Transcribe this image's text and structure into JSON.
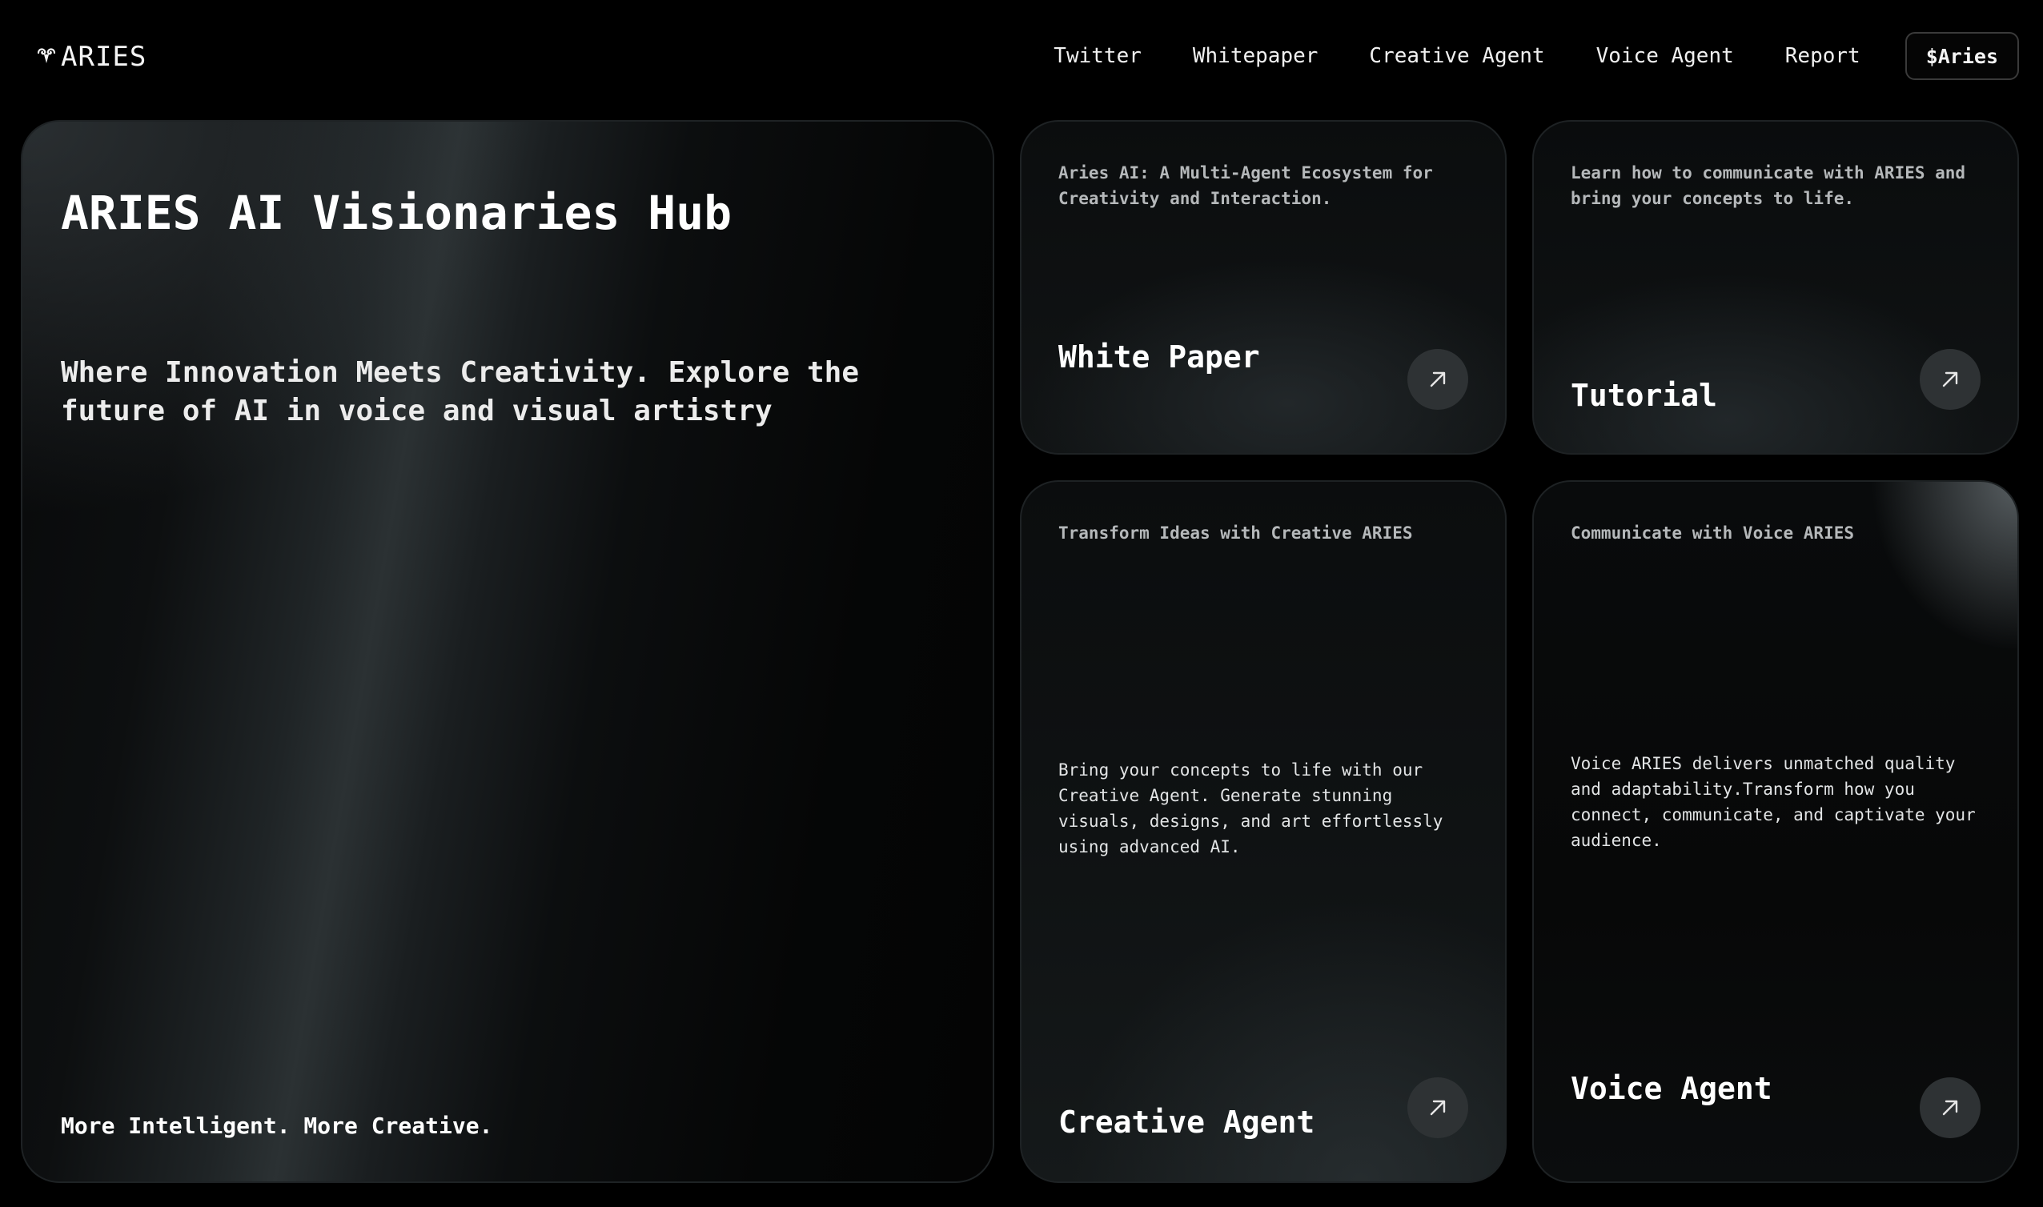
{
  "header": {
    "logo_text": "ARIES",
    "logo_icon": "ram-head-icon",
    "nav": [
      {
        "label": "Twitter"
      },
      {
        "label": "Whitepaper"
      },
      {
        "label": "Creative Agent"
      },
      {
        "label": "Voice Agent"
      },
      {
        "label": "Report"
      }
    ],
    "token_button_label": "$Aries"
  },
  "hero": {
    "title": "ARIES AI Visionaries Hub",
    "tagline": "Where Innovation Meets Creativity. Explore the future of AI in voice and visual artistry",
    "footer": "More Intelligent. More Creative."
  },
  "cards": {
    "whitepaper": {
      "subtitle": "Aries AI: A Multi-Agent Ecosystem for Creativity and Interaction.",
      "title": "White Paper",
      "icon": "arrow-up-right-icon"
    },
    "tutorial": {
      "subtitle": "Learn how to communicate with ARIES and bring your concepts to life.",
      "title": "Tutorial",
      "icon": "arrow-up-right-icon"
    },
    "creative": {
      "subtitle": "Transform Ideas with Creative ARIES",
      "body": "Bring your concepts to life with our Creative Agent. Generate stunning visuals, designs, and art effortlessly using advanced AI.",
      "title": "Creative Agent",
      "icon": "arrow-up-right-icon"
    },
    "voice": {
      "subtitle": "Communicate with Voice ARIES",
      "body": "Voice ARIES delivers unmatched quality and adaptability.Transform how you connect, communicate, and captivate your audience.",
      "title": "Voice Agent",
      "icon": "arrow-up-right-icon"
    }
  },
  "colors": {
    "background": "#000000",
    "card_border": "#1e2224",
    "arrow_button": "#2e3234",
    "text_primary": "#ffffff",
    "text_muted": "#b5b8ba"
  }
}
